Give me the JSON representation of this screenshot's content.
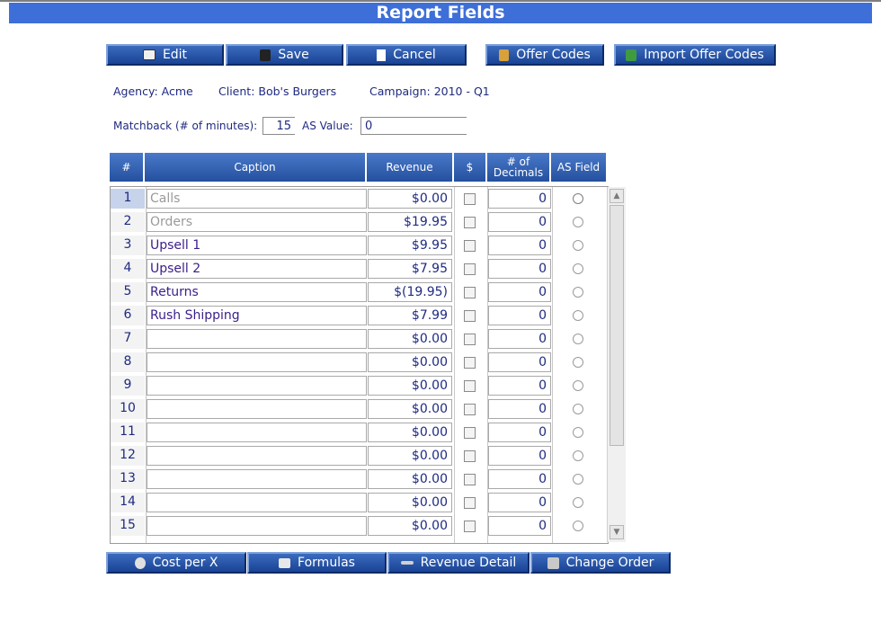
{
  "title": "Report Fields",
  "toolbar": {
    "edit": "Edit",
    "save": "Save",
    "cancel": "Cancel",
    "offer_codes": "Offer Codes",
    "import_offer_codes": "Import Offer Codes"
  },
  "info": {
    "agency_label": "Agency:",
    "agency": "Acme",
    "client_label": "Client:",
    "client": "Bob's Burgers",
    "campaign_label": "Campaign:",
    "campaign": "2010 - Q1",
    "matchback_label": "Matchback (# of minutes):",
    "matchback_value": "15",
    "as_value_label": "AS Value:",
    "as_value": "0"
  },
  "columns": [
    "#",
    "Caption",
    "Revenue",
    "$",
    "# of Decimals",
    "AS Field"
  ],
  "rows": [
    {
      "num": "1",
      "caption": "Calls",
      "revenue": "$0.00",
      "decimals": "0",
      "gray": true,
      "selected": true
    },
    {
      "num": "2",
      "caption": "Orders",
      "revenue": "$19.95",
      "decimals": "0",
      "gray": true
    },
    {
      "num": "3",
      "caption": "Upsell 1",
      "revenue": "$9.95",
      "decimals": "0"
    },
    {
      "num": "4",
      "caption": "Upsell 2",
      "revenue": "$7.95",
      "decimals": "0"
    },
    {
      "num": "5",
      "caption": "Returns",
      "revenue": "$(19.95)",
      "decimals": "0"
    },
    {
      "num": "6",
      "caption": "Rush Shipping",
      "revenue": "$7.99",
      "decimals": "0"
    },
    {
      "num": "7",
      "caption": "",
      "revenue": "$0.00",
      "decimals": "0"
    },
    {
      "num": "8",
      "caption": "",
      "revenue": "$0.00",
      "decimals": "0"
    },
    {
      "num": "9",
      "caption": "",
      "revenue": "$0.00",
      "decimals": "0"
    },
    {
      "num": "10",
      "caption": "",
      "revenue": "$0.00",
      "decimals": "0"
    },
    {
      "num": "11",
      "caption": "",
      "revenue": "$0.00",
      "decimals": "0"
    },
    {
      "num": "12",
      "caption": "",
      "revenue": "$0.00",
      "decimals": "0"
    },
    {
      "num": "13",
      "caption": "",
      "revenue": "$0.00",
      "decimals": "0"
    },
    {
      "num": "14",
      "caption": "",
      "revenue": "$0.00",
      "decimals": "0"
    },
    {
      "num": "15",
      "caption": "",
      "revenue": "$0.00",
      "decimals": "0"
    }
  ],
  "bottom": {
    "cost_per_x": "Cost per X",
    "formulas": "Formulas",
    "revenue_detail": "Revenue Detail",
    "change_order": "Change Order"
  },
  "colors": {
    "title_bar": "#3e6fd8",
    "button": "#1a4395",
    "header": "#24509e",
    "text": "#1f2a80"
  }
}
